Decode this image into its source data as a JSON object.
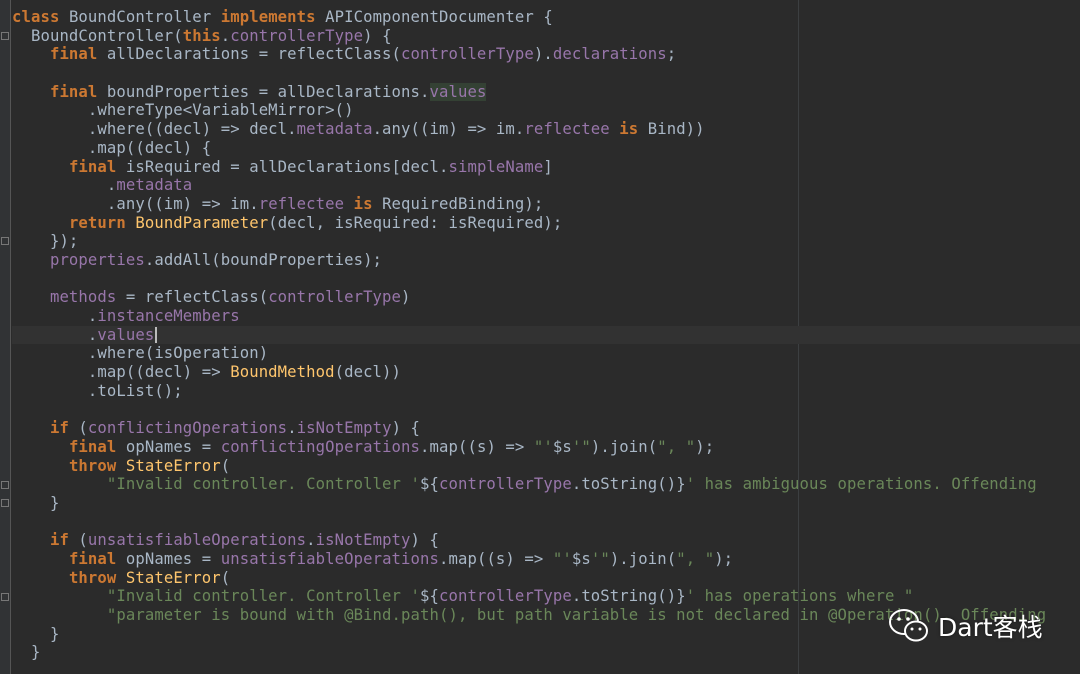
{
  "editor": {
    "lines": [
      [
        [
          "kw",
          "class "
        ],
        [
          "t",
          "BoundController "
        ],
        [
          "kw",
          "implements "
        ],
        [
          "t",
          "APIComponentDocumenter {"
        ]
      ],
      [
        [
          "t",
          "  BoundController("
        ],
        [
          "kw",
          "this"
        ],
        [
          "t",
          "."
        ],
        [
          "fld",
          "controllerType"
        ],
        [
          "t",
          ") {"
        ]
      ],
      [
        [
          "t",
          "    "
        ],
        [
          "kw",
          "final "
        ],
        [
          "t",
          "allDeclarations = reflectClass("
        ],
        [
          "fld",
          "controllerType"
        ],
        [
          "t",
          ")."
        ],
        [
          "fld",
          "declarations"
        ],
        [
          "t",
          ";"
        ]
      ],
      [],
      [
        [
          "t",
          "    "
        ],
        [
          "kw",
          "final "
        ],
        [
          "t",
          "boundProperties = allDeclarations."
        ],
        [
          "fldhl",
          "values"
        ]
      ],
      [
        [
          "t",
          "        .whereType<VariableMirror>()"
        ]
      ],
      [
        [
          "t",
          "        .where((decl) => decl."
        ],
        [
          "fld",
          "metadata"
        ],
        [
          "t",
          ".any((im) => im."
        ],
        [
          "fld",
          "reflectee "
        ],
        [
          "kw",
          "is "
        ],
        [
          "t",
          "Bind))"
        ]
      ],
      [
        [
          "t",
          "        .map((decl) {"
        ]
      ],
      [
        [
          "t",
          "      "
        ],
        [
          "kw",
          "final "
        ],
        [
          "t",
          "isRequired = allDeclarations[decl."
        ],
        [
          "fld",
          "simpleName"
        ],
        [
          "t",
          "]"
        ]
      ],
      [
        [
          "t",
          "          ."
        ],
        [
          "fld",
          "metadata"
        ]
      ],
      [
        [
          "t",
          "          .any((im) => im."
        ],
        [
          "fld",
          "reflectee "
        ],
        [
          "kw",
          "is "
        ],
        [
          "t",
          "RequiredBinding);"
        ]
      ],
      [
        [
          "t",
          "      "
        ],
        [
          "kw",
          "return "
        ],
        [
          "fn",
          "BoundParameter"
        ],
        [
          "t",
          "(decl, isRequired: isRequired);"
        ]
      ],
      [
        [
          "t",
          "    });"
        ]
      ],
      [
        [
          "t",
          "    "
        ],
        [
          "fld",
          "properties"
        ],
        [
          "t",
          ".addAll(boundProperties);"
        ]
      ],
      [],
      [
        [
          "t",
          "    "
        ],
        [
          "fld",
          "methods "
        ],
        [
          "t",
          "= reflectClass("
        ],
        [
          "fld",
          "controllerType"
        ],
        [
          "t",
          ")"
        ]
      ],
      [
        [
          "t",
          "        ."
        ],
        [
          "fld",
          "instanceMembers"
        ]
      ],
      [
        [
          "t",
          "        ."
        ],
        [
          "fld",
          "values"
        ],
        [
          "caret",
          ""
        ]
      ],
      [
        [
          "t",
          "        .where(isOperation)"
        ]
      ],
      [
        [
          "t",
          "        .map((decl) => "
        ],
        [
          "fn",
          "BoundMethod"
        ],
        [
          "t",
          "(decl))"
        ]
      ],
      [
        [
          "t",
          "        .toList();"
        ]
      ],
      [],
      [
        [
          "t",
          "    "
        ],
        [
          "kw",
          "if "
        ],
        [
          "t",
          "("
        ],
        [
          "fld",
          "conflictingOperations"
        ],
        [
          "t",
          "."
        ],
        [
          "fld",
          "isNotEmpty"
        ],
        [
          "t",
          ") {"
        ]
      ],
      [
        [
          "t",
          "      "
        ],
        [
          "kw",
          "final "
        ],
        [
          "t",
          "opNames = "
        ],
        [
          "fld",
          "conflictingOperations"
        ],
        [
          "t",
          ".map((s) => "
        ],
        [
          "str",
          "\"'"
        ],
        [
          "t",
          "$s"
        ],
        [
          "str",
          "'\""
        ],
        [
          "t",
          ").join("
        ],
        [
          "str",
          "\", \""
        ],
        [
          "t",
          ");"
        ]
      ],
      [
        [
          "t",
          "      "
        ],
        [
          "kw",
          "throw "
        ],
        [
          "fn",
          "StateError"
        ],
        [
          "t",
          "("
        ]
      ],
      [
        [
          "str",
          "          \"Invalid controller. Controller '"
        ],
        [
          "t",
          "${"
        ],
        [
          "fld",
          "controllerType"
        ],
        [
          "t",
          ".toString()}"
        ],
        [
          "str",
          "' has ambiguous operations. Offending"
        ]
      ],
      [
        [
          "t",
          "    }"
        ]
      ],
      [],
      [
        [
          "t",
          "    "
        ],
        [
          "kw",
          "if "
        ],
        [
          "t",
          "("
        ],
        [
          "fld",
          "unsatisfiableOperations"
        ],
        [
          "t",
          "."
        ],
        [
          "fld",
          "isNotEmpty"
        ],
        [
          "t",
          ") {"
        ]
      ],
      [
        [
          "t",
          "      "
        ],
        [
          "kw",
          "final "
        ],
        [
          "t",
          "opNames = "
        ],
        [
          "fld",
          "unsatisfiableOperations"
        ],
        [
          "t",
          ".map((s) => "
        ],
        [
          "str",
          "\"'"
        ],
        [
          "t",
          "$s"
        ],
        [
          "str",
          "'\""
        ],
        [
          "t",
          ").join("
        ],
        [
          "str",
          "\", \""
        ],
        [
          "t",
          ");"
        ]
      ],
      [
        [
          "t",
          "      "
        ],
        [
          "kw",
          "throw "
        ],
        [
          "fn",
          "StateError"
        ],
        [
          "t",
          "("
        ]
      ],
      [
        [
          "str",
          "          \"Invalid controller. Controller '"
        ],
        [
          "t",
          "${"
        ],
        [
          "fld",
          "controllerType"
        ],
        [
          "t",
          ".toString()}"
        ],
        [
          "str",
          "' has operations where \""
        ]
      ],
      [
        [
          "str",
          "          \"parameter is bound with @Bind.path(), but path variable is not declared in @Operation(). Offending"
        ]
      ],
      [
        [
          "t",
          "    }"
        ]
      ],
      [
        [
          "t",
          "  }"
        ]
      ]
    ],
    "current_line": 17,
    "fold_markers_at": [
      1,
      12,
      25,
      26,
      31
    ]
  },
  "watermark": {
    "label": "Dart客栈",
    "icon": "wechat-icon"
  }
}
